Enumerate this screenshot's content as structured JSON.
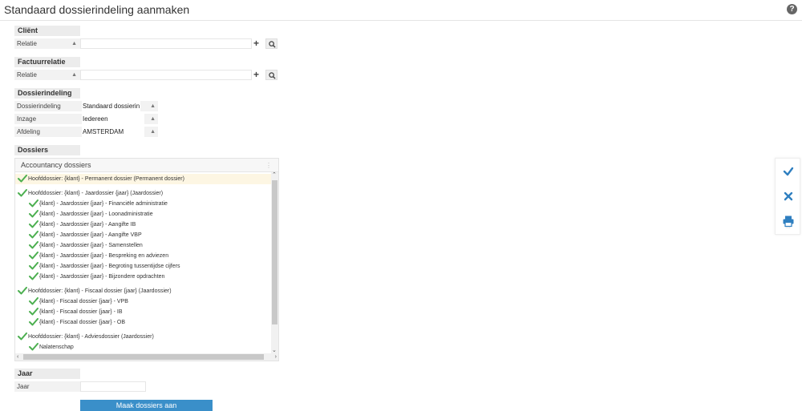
{
  "page": {
    "title": "Standaard dossierindeling aanmaken"
  },
  "client": {
    "header": "Cliënt",
    "label": "Relatie",
    "value": ""
  },
  "factuurrelatie": {
    "header": "Factuurrelatie",
    "label": "Relatie",
    "value": ""
  },
  "dossierindeling": {
    "header": "Dossierindeling",
    "rows": [
      {
        "label": "Dossierindeling",
        "value": "Standaard dossierin"
      },
      {
        "label": "Inzage",
        "value": "Iedereen"
      },
      {
        "label": "Afdeling",
        "value": "AMSTERDAM"
      }
    ]
  },
  "dossiers": {
    "header": "Dossiers",
    "tree_header": "Accountancy dossiers",
    "items": [
      {
        "text": "Hoofddossier: {klant} - Permanent dossier (Permanent dossier)",
        "level": 0,
        "group_top": true
      },
      {
        "text": "Hoofddossier: {klant} - Jaardossier {jaar} (Jaardossier)",
        "level": 0,
        "group_top": true
      },
      {
        "text": "{klant} - Jaardossier {jaar} - Financiële administratie",
        "level": 1
      },
      {
        "text": "{klant} - Jaardossier {jaar} - Loonadministratie",
        "level": 1
      },
      {
        "text": "{klant} - Jaardossier {jaar} - Aangifte IB",
        "level": 1
      },
      {
        "text": "{klant} - Jaardossier {jaar} - Aangifte VBP",
        "level": 1
      },
      {
        "text": "{klant} - Jaardossier {jaar} - Samenstellen",
        "level": 1
      },
      {
        "text": "{klant} - Jaardossier {jaar} - Bespreking en adviezen",
        "level": 1
      },
      {
        "text": "{klant} - Jaardossier {jaar} - Begroting tussentijdse cijfers",
        "level": 1
      },
      {
        "text": "{klant} - Jaardossier {jaar} - Bijzondere opdrachten",
        "level": 1
      },
      {
        "text": "Hoofddossier: {klant} - Fiscaal dossier {jaar} (Jaardossier)",
        "level": 0,
        "group_top": true
      },
      {
        "text": "{klant} - Fiscaal dossier {jaar} - VPB",
        "level": 1
      },
      {
        "text": "{klant} - Fiscaal dossier {jaar} - IB",
        "level": 1
      },
      {
        "text": "{klant} - Fiscaal dossier {jaar} - OB",
        "level": 1
      },
      {
        "text": "Hoofddossier: {klant} - Adviesdossier (Jaardossier)",
        "level": 0,
        "group_top": true
      },
      {
        "text": "Nalatenschap",
        "level": 1
      }
    ]
  },
  "jaar": {
    "header": "Jaar",
    "label": "Jaar",
    "value": ""
  },
  "submit": {
    "label": "Maak dossiers aan"
  },
  "colors": {
    "accent": "#3a8fc9",
    "check": "#4caf50",
    "highlight": "#fdf6e3"
  }
}
